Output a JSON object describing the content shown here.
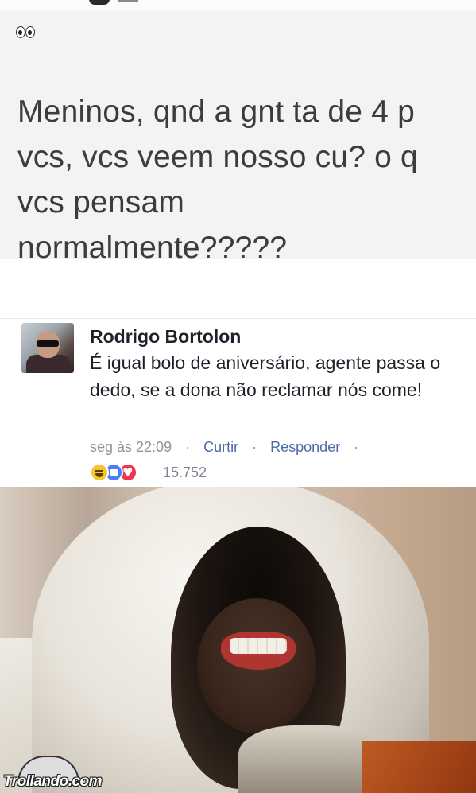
{
  "post": {
    "emoji": "👀",
    "text": "Meninos, qnd a gnt ta de 4 p vcs, vcs veem nosso cu? o q vcs pensam normalmente?????"
  },
  "comment": {
    "author": "Rodrigo Bortolon",
    "text": "É igual bolo de aniversário, agente passa o dedo, se a dona não reclamar nós come!",
    "timestamp": "seg às 22:09",
    "like_label": "Curtir",
    "reply_label": "Responder",
    "separator": "·",
    "reactions": [
      "haha-icon",
      "like-icon",
      "love-icon"
    ],
    "reaction_count": "15.752"
  },
  "meme": {
    "watermark": "Trollando.com"
  }
}
